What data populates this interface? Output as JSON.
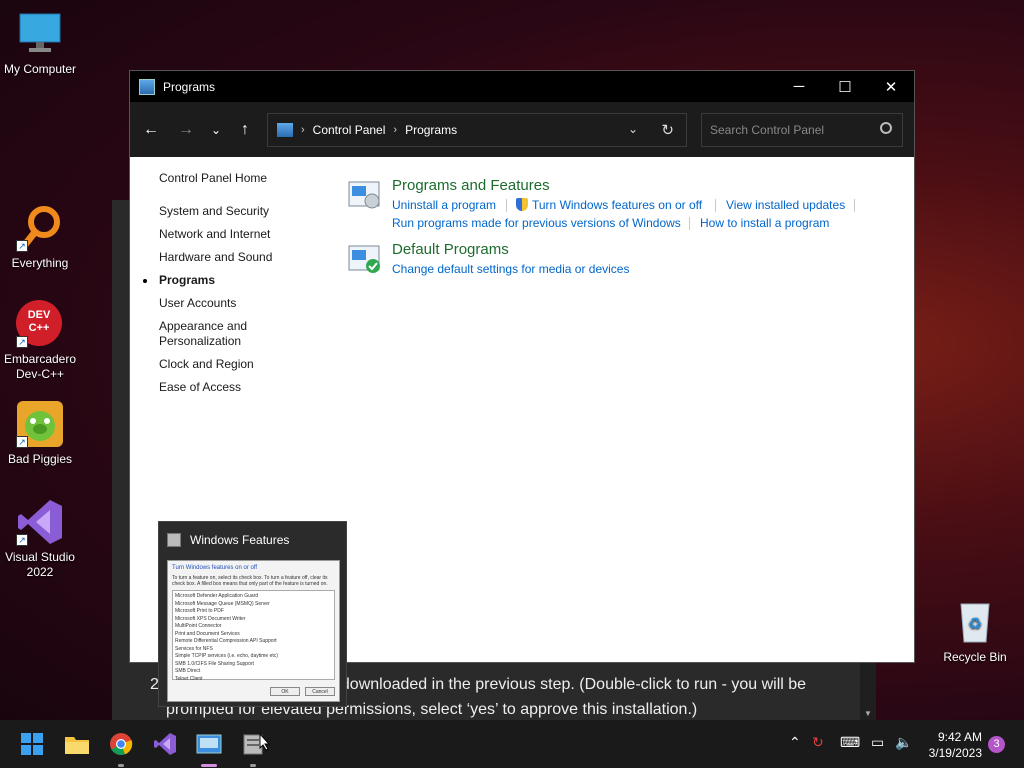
{
  "desktop": {
    "icons": [
      {
        "label": "My Computer"
      },
      {
        "label": "Everything"
      },
      {
        "label": "Embarcadero Dev-C++"
      },
      {
        "label": "Bad Piggies"
      },
      {
        "label": "Visual Studio 2022"
      },
      {
        "label": "Recycle Bin"
      }
    ],
    "devcpp_badge": "DEV C++"
  },
  "background_doc": {
    "text": "2. Run the installer downloaded in the previous step. (Double-click to run - you will be prompted for elevated permissions, select ‘yes’ to approve this installation.)",
    "visible_line1_tail": "downloaded in the previous step. (Double-click to run - you will be",
    "visible_line1_head": "2",
    "visible_line2": "prompted for elevated permissions, select ‘yes’ to approve this installation.)"
  },
  "window": {
    "title": "Programs",
    "breadcrumb": [
      "Control Panel",
      "Programs"
    ],
    "search_placeholder": "Search Control Panel"
  },
  "leftnav": {
    "home": "Control Panel Home",
    "items": [
      {
        "label": "System and Security"
      },
      {
        "label": "Network and Internet"
      },
      {
        "label": "Hardware and Sound"
      },
      {
        "label": "Programs"
      },
      {
        "label": "User Accounts"
      },
      {
        "label": "Appearance and Personalization"
      },
      {
        "label": "Clock and Region"
      },
      {
        "label": "Ease of Access"
      }
    ]
  },
  "sections": {
    "programs_features": {
      "title": "Programs and Features",
      "links": [
        "Uninstall a program",
        "Turn Windows features on or off",
        "View installed updates",
        "Run programs made for previous versions of Windows",
        "How to install a program"
      ]
    },
    "default_programs": {
      "title": "Default Programs",
      "links": [
        "Change default settings for media or devices"
      ]
    }
  },
  "thumbnail": {
    "title": "Windows Features",
    "preview_heading": "Turn Windows features on or off",
    "preview_desc": "To turn a feature on, select its check box. To turn a feature off, clear its check box. A filled box means that only part of the feature is turned on.",
    "preview_rows": [
      "Microsoft Defender Application Guard",
      "Microsoft Message Queue (MSMQ) Server",
      "Microsoft Print to PDF",
      "Microsoft XPS Document Writer",
      "MultiPoint Connector",
      "Print and Document Services",
      "Remote Differential Compression API Support",
      "Services for NFS",
      "Simple TCPIP services (i.e. echo, daytime etc)",
      "SMB 1.0/CIFS File Sharing Support",
      "SMB Direct",
      "Telnet Client"
    ],
    "ok": "OK",
    "cancel": "Cancel"
  },
  "taskbar": {
    "apps": [
      "windows-start",
      "file-explorer",
      "chrome",
      "visual-studio",
      "control-panel",
      "windows-features"
    ],
    "time": "9:42 AM",
    "date": "3/19/2023",
    "notifications": "3"
  }
}
